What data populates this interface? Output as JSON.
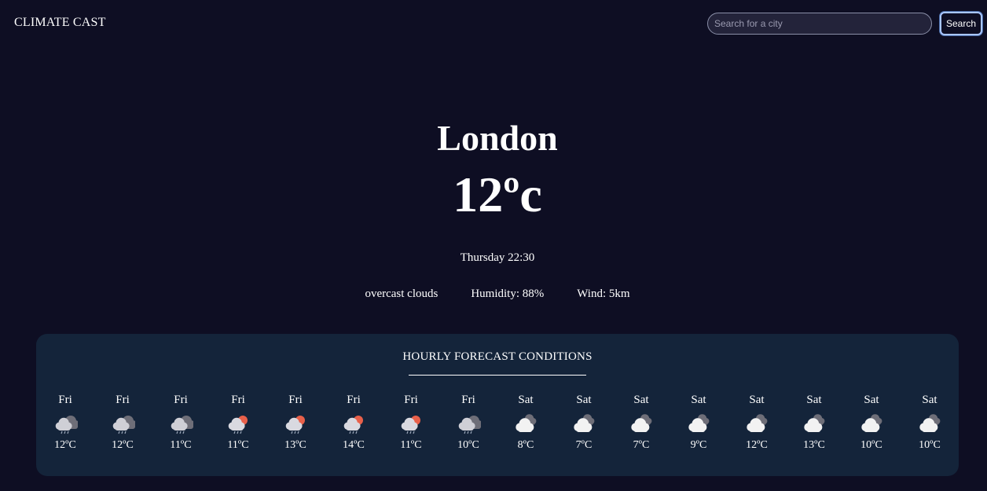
{
  "header": {
    "brand": "CLIMATE CAST",
    "search_placeholder": "Search for a city",
    "search_value": "",
    "search_button": "Search"
  },
  "current": {
    "city": "London",
    "temperature": "12ºc",
    "datetime": "Thursday 22:30",
    "description": "overcast clouds",
    "humidity": "Humidity: 88%",
    "wind": "Wind: 5km"
  },
  "forecast": {
    "title": "HOURLY FORECAST CONDITIONS",
    "hours": [
      {
        "day": "Fri",
        "temp": "12ºC",
        "icon": "rain-cloud-icon"
      },
      {
        "day": "Fri",
        "temp": "12ºC",
        "icon": "rain-cloud-icon"
      },
      {
        "day": "Fri",
        "temp": "11ºC",
        "icon": "rain-cloud-icon"
      },
      {
        "day": "Fri",
        "temp": "11ºC",
        "icon": "sun-rain-cloud-icon"
      },
      {
        "day": "Fri",
        "temp": "13ºC",
        "icon": "sun-rain-cloud-icon"
      },
      {
        "day": "Fri",
        "temp": "14ºC",
        "icon": "sun-rain-cloud-icon"
      },
      {
        "day": "Fri",
        "temp": "11ºC",
        "icon": "sun-rain-cloud-icon"
      },
      {
        "day": "Fri",
        "temp": "10ºC",
        "icon": "rain-cloud-icon"
      },
      {
        "day": "Sat",
        "temp": "8ºC",
        "icon": "overcast-clouds-icon"
      },
      {
        "day": "Sat",
        "temp": "7ºC",
        "icon": "overcast-clouds-icon"
      },
      {
        "day": "Sat",
        "temp": "7ºC",
        "icon": "overcast-clouds-icon"
      },
      {
        "day": "Sat",
        "temp": "9ºC",
        "icon": "overcast-clouds-icon"
      },
      {
        "day": "Sat",
        "temp": "12ºC",
        "icon": "overcast-clouds-icon"
      },
      {
        "day": "Sat",
        "temp": "13ºC",
        "icon": "overcast-clouds-icon"
      },
      {
        "day": "Sat",
        "temp": "10ºC",
        "icon": "overcast-clouds-icon"
      },
      {
        "day": "Sat",
        "temp": "10ºC",
        "icon": "overcast-clouds-icon"
      }
    ]
  },
  "colors": {
    "background": "#0e0e23",
    "panel": "#14243a",
    "sun": "#e8604a",
    "cloud_light": "#f2f2f2",
    "cloud_dark": "#6e6e78"
  }
}
